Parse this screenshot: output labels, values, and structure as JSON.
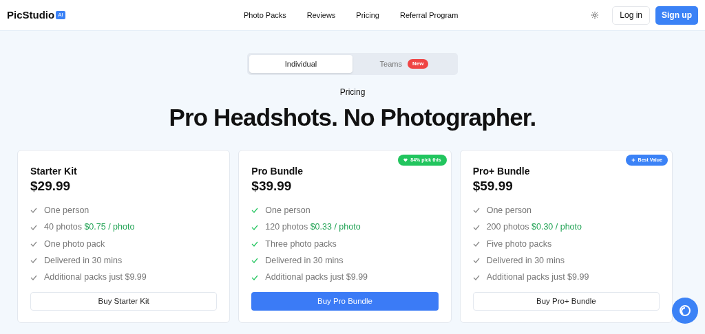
{
  "brand": {
    "name": "PicStudio",
    "badge": "AI"
  },
  "nav": [
    "Photo Packs",
    "Reviews",
    "Pricing",
    "Referral Program"
  ],
  "actions": {
    "login": "Log in",
    "signup": "Sign up"
  },
  "tabs": [
    {
      "label": "Individual",
      "selected": true
    },
    {
      "label": "Teams",
      "selected": false,
      "badge": "New"
    }
  ],
  "eyebrow": "Pricing",
  "headline": "Pro Headshots. No Photographer.",
  "plans": [
    {
      "name": "Starter Kit",
      "price": "$29.99",
      "highlighted": false,
      "features": [
        {
          "text": "One person"
        },
        {
          "text": "40 photos",
          "note": "$0.75 / photo"
        },
        {
          "text": "One photo pack"
        },
        {
          "text": "Delivered in 30 mins"
        },
        {
          "text": "Additional packs just $9.99"
        }
      ],
      "button": "Buy Starter Kit"
    },
    {
      "name": "Pro Bundle",
      "price": "$39.99",
      "highlighted": true,
      "tag": {
        "kind": "heart",
        "text": "84% pick this",
        "color": "#22c55e"
      },
      "features": [
        {
          "text": "One person"
        },
        {
          "text": "120 photos",
          "note": "$0.33 / photo"
        },
        {
          "text": "Three photo packs"
        },
        {
          "text": "Delivered in 30 mins"
        },
        {
          "text": "Additional packs just $9.99"
        }
      ],
      "button": "Buy Pro Bundle"
    },
    {
      "name": "Pro+ Bundle",
      "price": "$59.99",
      "highlighted": false,
      "tag": {
        "kind": "plus",
        "text": "Best Value",
        "color": "#3b82f6"
      },
      "features": [
        {
          "text": "One person"
        },
        {
          "text": "200 photos",
          "note": "$0.30 / photo"
        },
        {
          "text": "Five photo packs"
        },
        {
          "text": "Delivered in 30 mins"
        },
        {
          "text": "Additional packs just $9.99"
        }
      ],
      "button": "Buy Pro+ Bundle"
    }
  ]
}
